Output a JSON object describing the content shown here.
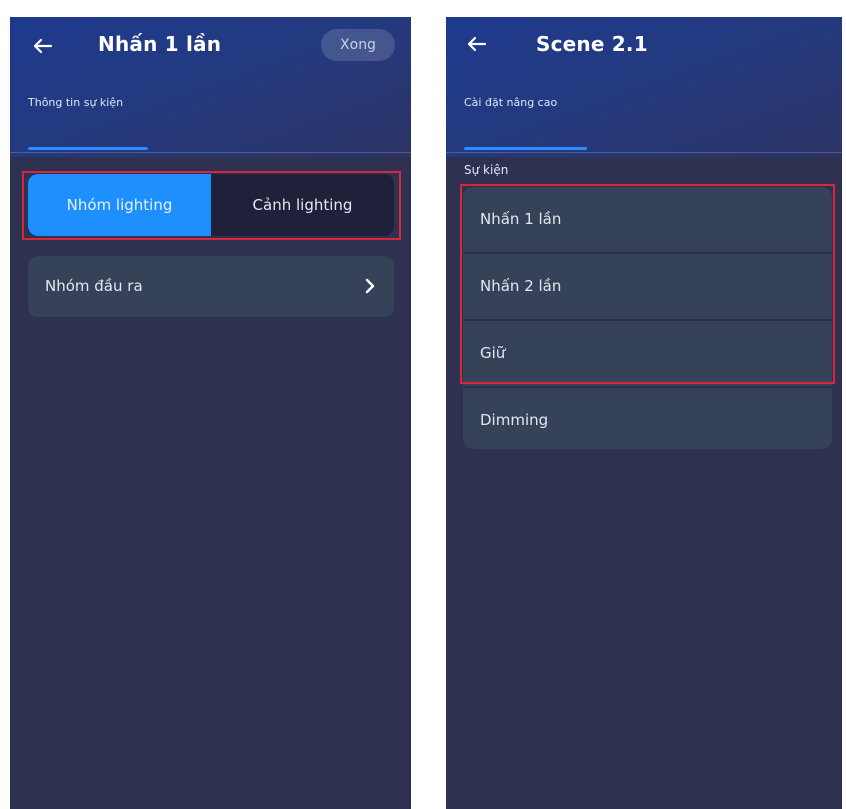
{
  "left_screen": {
    "title": "Nhấn 1 lần",
    "done_label": "Xong",
    "tab": "Thông tin sự kiện",
    "segment": {
      "options": [
        "Nhóm lighting",
        "Cảnh lighting"
      ],
      "selected": "Nhóm lighting"
    },
    "row_label": "Nhóm đầu ra"
  },
  "right_screen": {
    "title": "Scene 2.1",
    "tab": "Cài đặt nâng cao",
    "section_label": "Sự kiện",
    "events": [
      "Nhấn 1 lần",
      "Nhấn 2 lần",
      "Giữ",
      "Dimming"
    ]
  },
  "colors": {
    "accent": "#1e8fff",
    "highlight_box": "#d8263e",
    "background": "#2e3150",
    "card": "#364258"
  },
  "icons": {
    "back": "arrow-left-icon",
    "chevron": "chevron-right-icon"
  }
}
